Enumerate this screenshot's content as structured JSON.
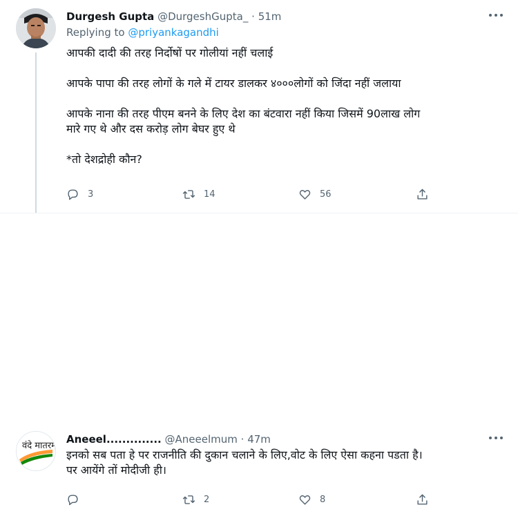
{
  "tweets": [
    {
      "name": "Durgesh Gupta",
      "handle": "@DurgeshGupta_",
      "separator": "·",
      "time": "51m",
      "replying_prefix": "Replying to",
      "replying_to": "@priyankagandhi",
      "paragraphs": [
        "आपकी दादी की तरह निर्दोषों पर गोलीयां नहीं चलाई",
        "आपके पापा की तरह लोगों के गले में टायर डालकर ४०००लोगों को जिंदा नहीं जलाया",
        "आपके नाना की तरह पीएम बनने के लिए देश का बंटवारा नहीं किया जिसमें 90लाख लोग\nमारे गए थे और दस करोड़ लोग बेघर हुए थे",
        "*तो  देशद्रोही कौन?"
      ],
      "replies": "3",
      "retweets": "14",
      "likes": "56"
    },
    {
      "name": "Aneeel..............",
      "handle": "@Aneeelmum",
      "separator": "·",
      "time": "47m",
      "paragraphs": [
        "इनको सब पता हे पर राजनीति की दुकान चलाने के लिए,वोट के लिए ऐसा कहना पडता है।\nपर आयेंगे तों मोदीजी ही।"
      ],
      "replies": "",
      "retweets": "2",
      "likes": "8",
      "avatar_text": "वंदे मातरम्"
    }
  ],
  "icons": [
    "reply-icon",
    "retweet-icon",
    "like-icon",
    "share-icon",
    "more-icon"
  ],
  "colors": {
    "link": "#1d9bf0",
    "secondary": "#536471",
    "text": "#0f1419"
  }
}
